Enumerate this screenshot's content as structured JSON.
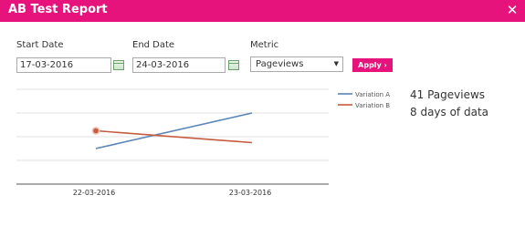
{
  "window": {
    "title": "AB Test Report",
    "close_glyph": "✕"
  },
  "filters": {
    "start_label": "Start Date",
    "start_value": "17-03-2016",
    "end_label": "End Date",
    "end_value": "24-03-2016",
    "metric_label": "Metric",
    "metric_value": "Pageviews",
    "apply_label": "Apply ›"
  },
  "stats": {
    "pageviews_text": "41 Pageviews",
    "days_text": "8 days of data"
  },
  "chart_data": {
    "type": "line",
    "x": [
      "22-03-2016",
      "23-03-2016"
    ],
    "grid": true,
    "legend_position": "top-right",
    "series": [
      {
        "name": "Variation A",
        "color": "#5b86b8",
        "values": [
          3.0,
          6.0
        ]
      },
      {
        "name": "Variation B",
        "color": "#c65b3f",
        "values": [
          4.5,
          3.5
        ],
        "highlight_first_point": true
      }
    ],
    "ylim": [
      0,
      8
    ]
  }
}
